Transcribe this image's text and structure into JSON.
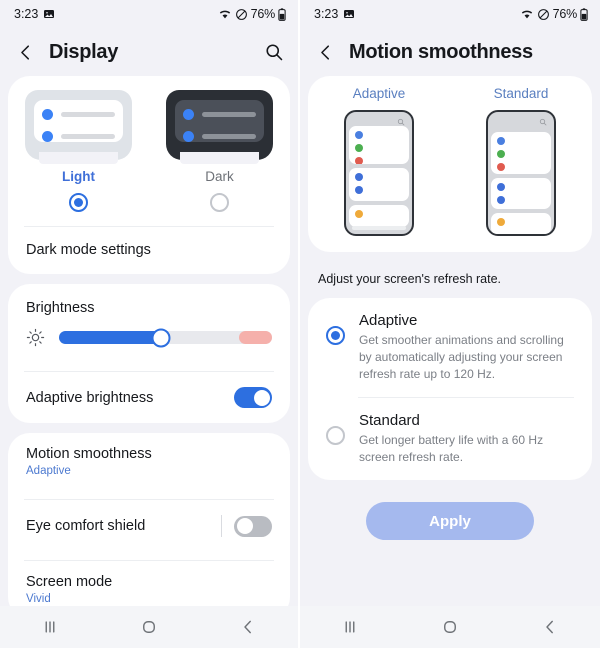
{
  "status_bar": {
    "time": "3:23",
    "battery_percent": "76%",
    "icons": [
      "image-icon",
      "wifi-icon",
      "mute-icon",
      "battery-icon"
    ]
  },
  "display_screen": {
    "header": {
      "title": "Display",
      "back_icon": "chevron-left-icon",
      "search_icon": "search-icon"
    },
    "theme": {
      "options": [
        {
          "label": "Light",
          "selected": true
        },
        {
          "label": "Dark",
          "selected": false
        }
      ],
      "dark_mode_settings_label": "Dark mode settings"
    },
    "brightness": {
      "title": "Brightness",
      "sun_icon": "brightness-icon",
      "value_percent": 48,
      "warn_zone_percent": 15
    },
    "adaptive_brightness": {
      "label": "Adaptive brightness",
      "enabled": true
    },
    "motion_smoothness": {
      "label": "Motion smoothness",
      "value": "Adaptive"
    },
    "eye_comfort_shield": {
      "label": "Eye comfort shield",
      "enabled": false
    },
    "screen_mode": {
      "label": "Screen mode",
      "value": "Vivid"
    }
  },
  "motion_screen": {
    "header": {
      "title": "Motion smoothness",
      "back_icon": "chevron-left-icon"
    },
    "previews": [
      {
        "label": "Adaptive"
      },
      {
        "label": "Standard"
      }
    ],
    "hint": "Adjust your screen's refresh rate.",
    "options": [
      {
        "title": "Adaptive",
        "description": "Get smoother animations and scrolling by automatically adjusting your screen refresh rate up to 120 Hz.",
        "selected": true
      },
      {
        "title": "Standard",
        "description": "Get longer battery life with a 60 Hz screen refresh rate.",
        "selected": false
      }
    ],
    "apply_label": "Apply"
  },
  "nav_bar": {
    "recents_icon": "recents-icon",
    "home_icon": "home-icon",
    "back_icon": "back-icon"
  },
  "colors": {
    "accent": "#2d6fe0",
    "background": "#f2f2f7",
    "card": "#ffffff",
    "warn": "#f5b0ab",
    "apply_disabled": "#a5b9ee"
  }
}
